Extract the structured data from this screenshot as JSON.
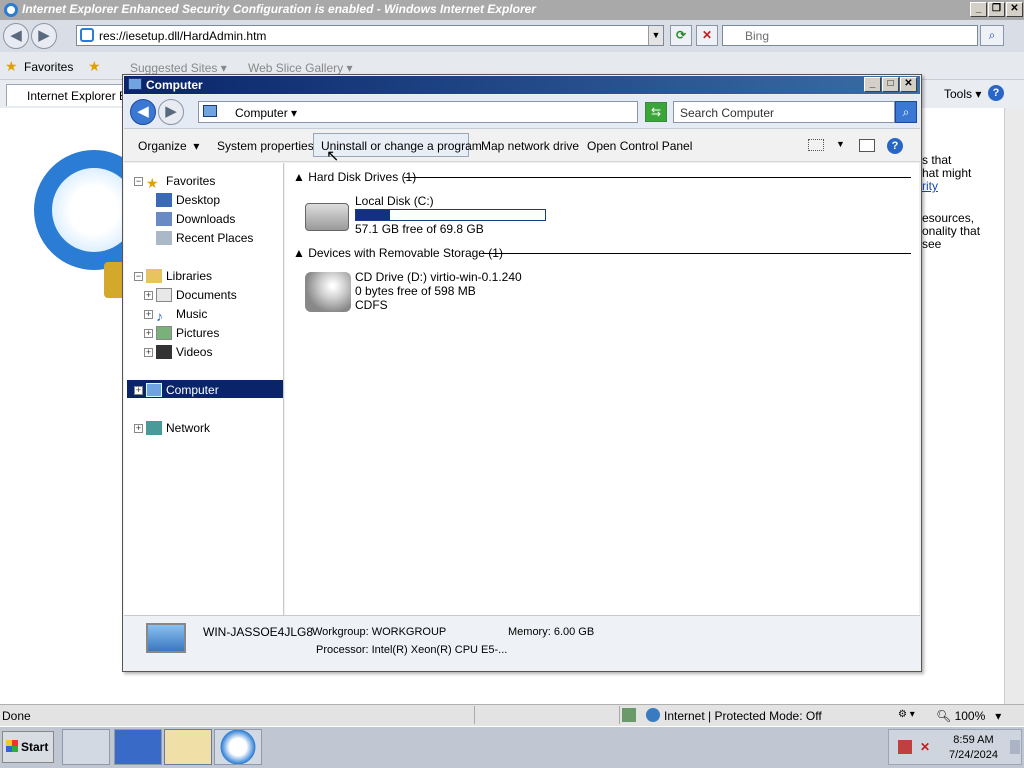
{
  "ie": {
    "title": "Internet Explorer Enhanced Security Configuration is enabled - Windows Internet Explorer",
    "address": "res://iesetup.dll/HardAdmin.htm",
    "search_placeholder": "Bing",
    "favorites_label": "Favorites",
    "suggested_sites": "Suggested Sites",
    "web_slice": "Web Slice Gallery",
    "tab_label": "Internet Explorer Er",
    "tools_label": "Tools",
    "content_snippets": [
      "s that",
      "hat might",
      "rity",
      "esources,",
      "onality that",
      "see"
    ],
    "status_done": "Done",
    "status_zone": "Internet | Protected Mode: Off",
    "zoom": "100%"
  },
  "explorer": {
    "title": "Computer",
    "breadcrumb": "Computer",
    "search_placeholder": "Search Computer",
    "toolbar": [
      "Organize",
      "System properties",
      "Uninstall or change a program",
      "Map network drive",
      "Open Control Panel"
    ],
    "tree": {
      "favorites": "Favorites",
      "desktop": "Desktop",
      "downloads": "Downloads",
      "recent": "Recent Places",
      "libraries": "Libraries",
      "documents": "Documents",
      "music": "Music",
      "pictures": "Pictures",
      "videos": "Videos",
      "computer": "Computer",
      "network": "Network"
    },
    "groups": {
      "hdd": "Hard Disk Drives (1)",
      "removable": "Devices with Removable Storage (1)"
    },
    "local_disk": {
      "name": "Local Disk (C:)",
      "free": "57.1 GB free of 69.8 GB",
      "used_fraction": 0.18
    },
    "cd_drive": {
      "name": "CD Drive (D:) virtio-win-0.1.240",
      "free": "0 bytes free of 598 MB",
      "fs": "CDFS"
    },
    "details": {
      "name": "WIN-JASSOE4JLG8",
      "workgroup": "Workgroup: WORKGROUP",
      "memory": "Memory: 6.00 GB",
      "processor": "Processor: Intel(R) Xeon(R) CPU E5-..."
    }
  },
  "taskbar": {
    "start": "Start",
    "time": "8:59 AM",
    "date": "7/24/2024"
  }
}
